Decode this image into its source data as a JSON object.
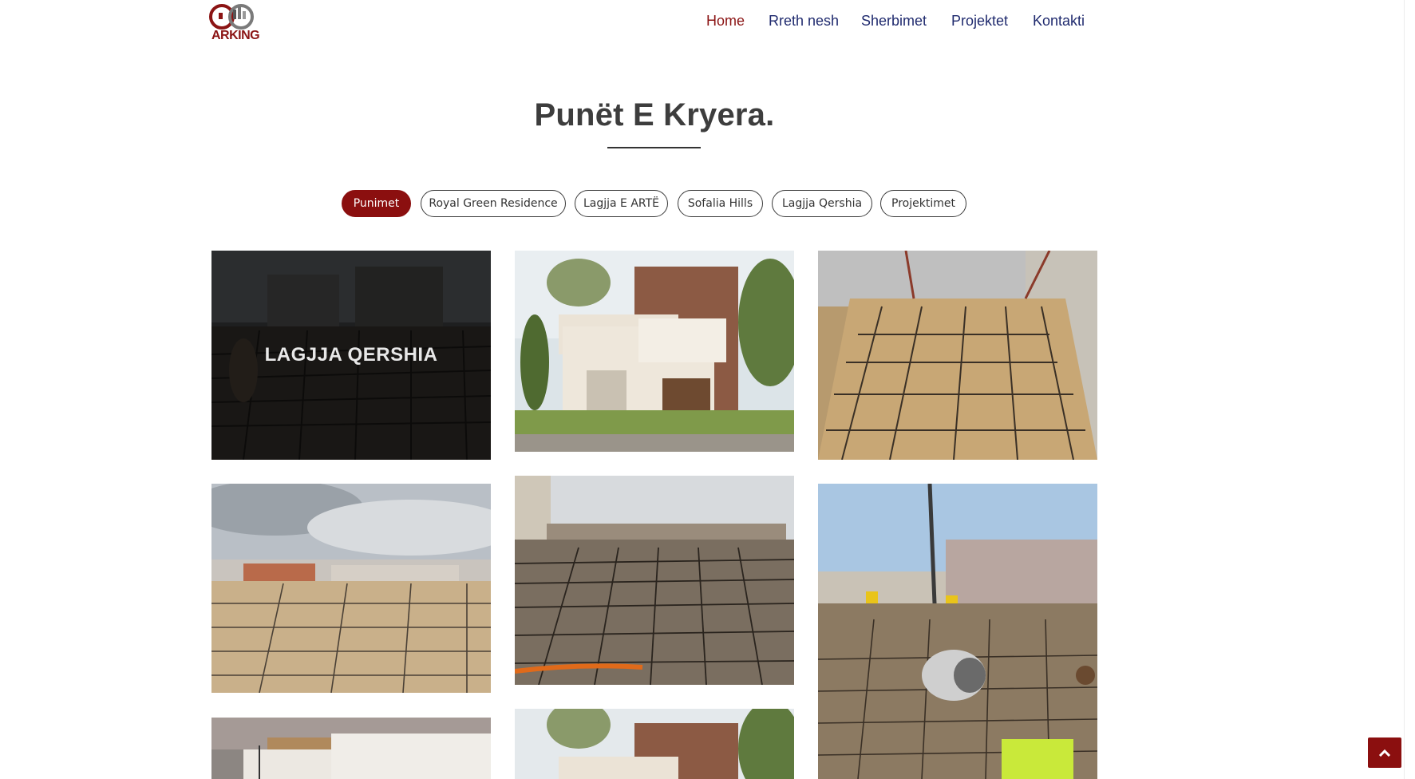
{
  "brand": {
    "name": "ARKING",
    "logo_icon": "arking-logo-icon",
    "accent": "#8b0f0f",
    "nav_color": "#1f2a6e"
  },
  "nav": {
    "items": [
      {
        "label": "Home",
        "active": true
      },
      {
        "label": "Rreth nesh",
        "active": false
      },
      {
        "label": "Sherbimet",
        "active": false
      },
      {
        "label": "Projektet",
        "active": false
      },
      {
        "label": "Kontakti",
        "active": false
      }
    ]
  },
  "section": {
    "title": "Punët E Kryera."
  },
  "filters": [
    {
      "label": "Punimet",
      "active": true
    },
    {
      "label": "Royal Green Residence",
      "active": false
    },
    {
      "label": "Lagjja E ARTË",
      "active": false
    },
    {
      "label": "Sofalia Hills",
      "active": false
    },
    {
      "label": "Lagjja Qershia",
      "active": false
    },
    {
      "label": "Projektimet",
      "active": false
    }
  ],
  "gallery": {
    "hover_title": "LAGJJA QERSHIA",
    "items": [
      {
        "subject": "construction-rebar-photo",
        "overlay": true
      },
      {
        "subject": "house-render-photo"
      },
      {
        "subject": "formwork-rebar-photo"
      },
      {
        "subject": "foundation-slab-photo"
      },
      {
        "subject": "rebar-mesh-photo"
      },
      {
        "subject": "concrete-pouring-photo"
      },
      {
        "subject": "modern-house-photo"
      },
      {
        "subject": "house-render-photo"
      }
    ]
  },
  "back_to_top": {
    "icon": "chevron-up-icon"
  }
}
